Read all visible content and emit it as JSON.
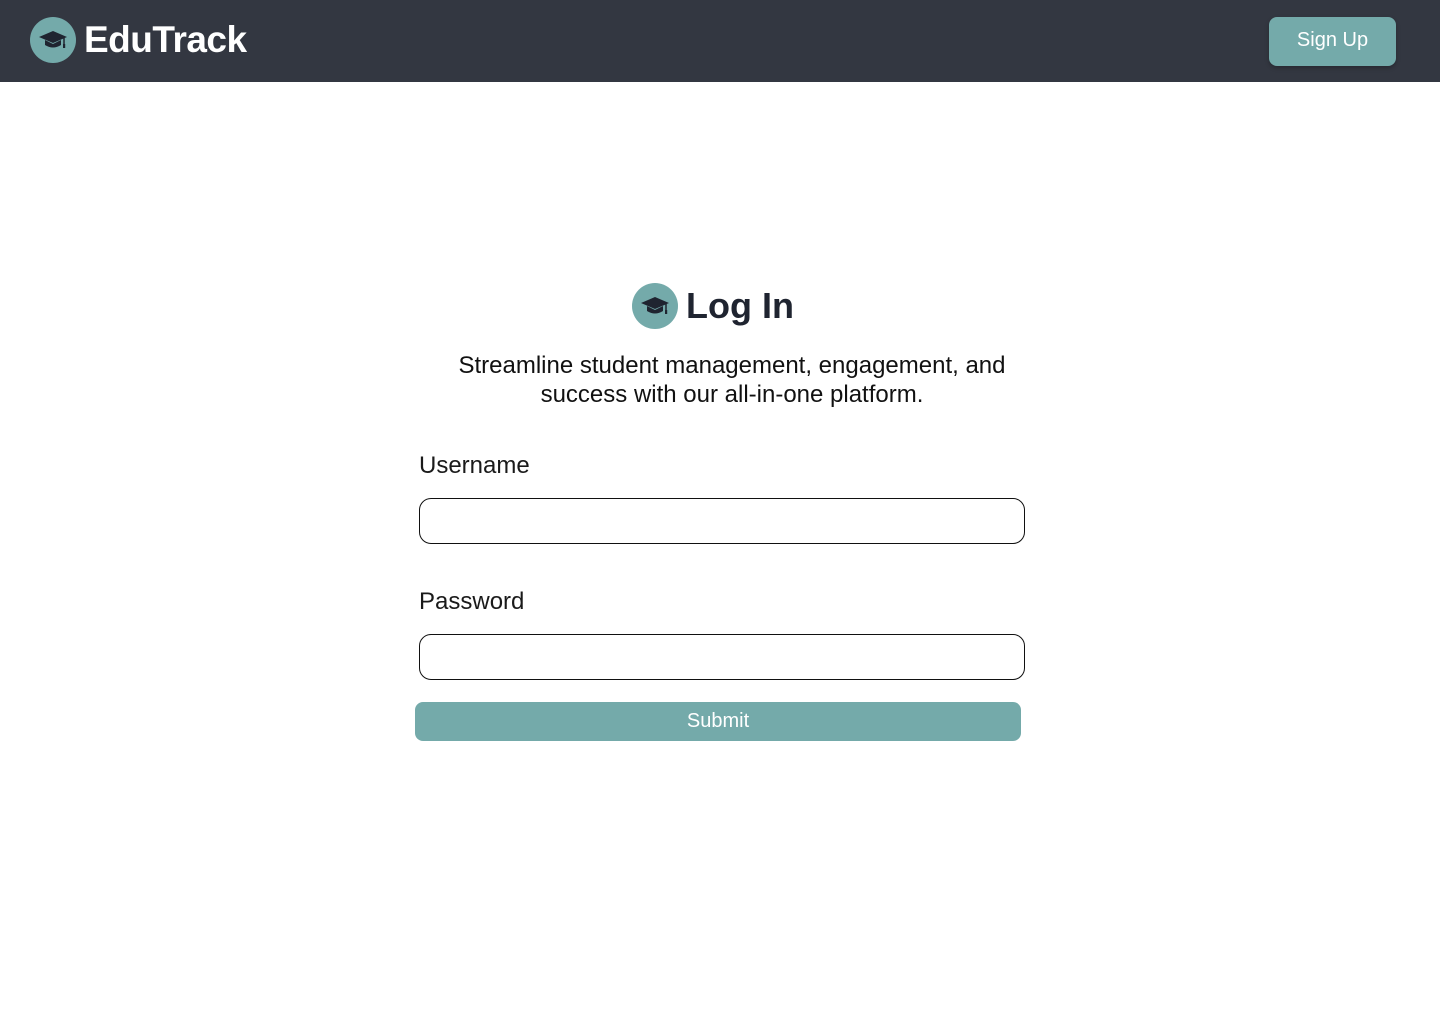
{
  "header": {
    "brand": "EduTrack",
    "logo_icon": "graduation-cap-icon",
    "signup_label": "Sign Up"
  },
  "login": {
    "title": "Log In",
    "title_icon": "graduation-cap-icon",
    "subtitle": "Streamline student management, engagement, and success with our all-in-one platform.",
    "username_label": "Username",
    "username_value": "",
    "password_label": "Password",
    "password_value": "",
    "submit_label": "Submit"
  },
  "colors": {
    "header_bg": "#333741",
    "accent": "#74aaaa",
    "text_dark": "#1f2430"
  }
}
